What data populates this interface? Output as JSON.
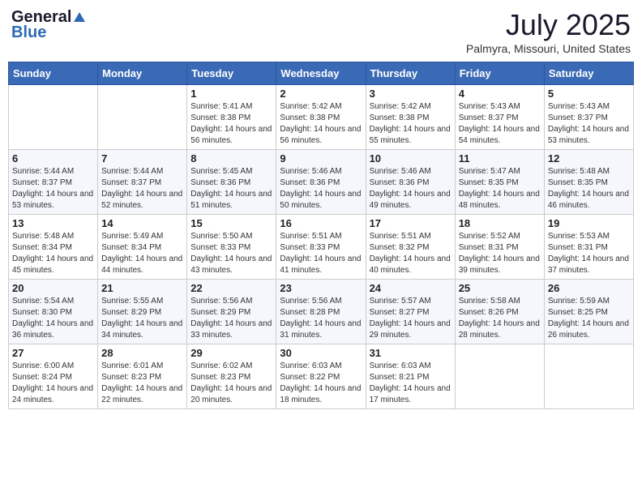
{
  "logo": {
    "general": "General",
    "blue": "Blue"
  },
  "title": "July 2025",
  "location": "Palmyra, Missouri, United States",
  "days_of_week": [
    "Sunday",
    "Monday",
    "Tuesday",
    "Wednesday",
    "Thursday",
    "Friday",
    "Saturday"
  ],
  "weeks": [
    [
      {
        "day": "",
        "sunrise": "",
        "sunset": "",
        "daylight": ""
      },
      {
        "day": "",
        "sunrise": "",
        "sunset": "",
        "daylight": ""
      },
      {
        "day": "1",
        "sunrise": "Sunrise: 5:41 AM",
        "sunset": "Sunset: 8:38 PM",
        "daylight": "Daylight: 14 hours and 56 minutes."
      },
      {
        "day": "2",
        "sunrise": "Sunrise: 5:42 AM",
        "sunset": "Sunset: 8:38 PM",
        "daylight": "Daylight: 14 hours and 56 minutes."
      },
      {
        "day": "3",
        "sunrise": "Sunrise: 5:42 AM",
        "sunset": "Sunset: 8:38 PM",
        "daylight": "Daylight: 14 hours and 55 minutes."
      },
      {
        "day": "4",
        "sunrise": "Sunrise: 5:43 AM",
        "sunset": "Sunset: 8:37 PM",
        "daylight": "Daylight: 14 hours and 54 minutes."
      },
      {
        "day": "5",
        "sunrise": "Sunrise: 5:43 AM",
        "sunset": "Sunset: 8:37 PM",
        "daylight": "Daylight: 14 hours and 53 minutes."
      }
    ],
    [
      {
        "day": "6",
        "sunrise": "Sunrise: 5:44 AM",
        "sunset": "Sunset: 8:37 PM",
        "daylight": "Daylight: 14 hours and 53 minutes."
      },
      {
        "day": "7",
        "sunrise": "Sunrise: 5:44 AM",
        "sunset": "Sunset: 8:37 PM",
        "daylight": "Daylight: 14 hours and 52 minutes."
      },
      {
        "day": "8",
        "sunrise": "Sunrise: 5:45 AM",
        "sunset": "Sunset: 8:36 PM",
        "daylight": "Daylight: 14 hours and 51 minutes."
      },
      {
        "day": "9",
        "sunrise": "Sunrise: 5:46 AM",
        "sunset": "Sunset: 8:36 PM",
        "daylight": "Daylight: 14 hours and 50 minutes."
      },
      {
        "day": "10",
        "sunrise": "Sunrise: 5:46 AM",
        "sunset": "Sunset: 8:36 PM",
        "daylight": "Daylight: 14 hours and 49 minutes."
      },
      {
        "day": "11",
        "sunrise": "Sunrise: 5:47 AM",
        "sunset": "Sunset: 8:35 PM",
        "daylight": "Daylight: 14 hours and 48 minutes."
      },
      {
        "day": "12",
        "sunrise": "Sunrise: 5:48 AM",
        "sunset": "Sunset: 8:35 PM",
        "daylight": "Daylight: 14 hours and 46 minutes."
      }
    ],
    [
      {
        "day": "13",
        "sunrise": "Sunrise: 5:48 AM",
        "sunset": "Sunset: 8:34 PM",
        "daylight": "Daylight: 14 hours and 45 minutes."
      },
      {
        "day": "14",
        "sunrise": "Sunrise: 5:49 AM",
        "sunset": "Sunset: 8:34 PM",
        "daylight": "Daylight: 14 hours and 44 minutes."
      },
      {
        "day": "15",
        "sunrise": "Sunrise: 5:50 AM",
        "sunset": "Sunset: 8:33 PM",
        "daylight": "Daylight: 14 hours and 43 minutes."
      },
      {
        "day": "16",
        "sunrise": "Sunrise: 5:51 AM",
        "sunset": "Sunset: 8:33 PM",
        "daylight": "Daylight: 14 hours and 41 minutes."
      },
      {
        "day": "17",
        "sunrise": "Sunrise: 5:51 AM",
        "sunset": "Sunset: 8:32 PM",
        "daylight": "Daylight: 14 hours and 40 minutes."
      },
      {
        "day": "18",
        "sunrise": "Sunrise: 5:52 AM",
        "sunset": "Sunset: 8:31 PM",
        "daylight": "Daylight: 14 hours and 39 minutes."
      },
      {
        "day": "19",
        "sunrise": "Sunrise: 5:53 AM",
        "sunset": "Sunset: 8:31 PM",
        "daylight": "Daylight: 14 hours and 37 minutes."
      }
    ],
    [
      {
        "day": "20",
        "sunrise": "Sunrise: 5:54 AM",
        "sunset": "Sunset: 8:30 PM",
        "daylight": "Daylight: 14 hours and 36 minutes."
      },
      {
        "day": "21",
        "sunrise": "Sunrise: 5:55 AM",
        "sunset": "Sunset: 8:29 PM",
        "daylight": "Daylight: 14 hours and 34 minutes."
      },
      {
        "day": "22",
        "sunrise": "Sunrise: 5:56 AM",
        "sunset": "Sunset: 8:29 PM",
        "daylight": "Daylight: 14 hours and 33 minutes."
      },
      {
        "day": "23",
        "sunrise": "Sunrise: 5:56 AM",
        "sunset": "Sunset: 8:28 PM",
        "daylight": "Daylight: 14 hours and 31 minutes."
      },
      {
        "day": "24",
        "sunrise": "Sunrise: 5:57 AM",
        "sunset": "Sunset: 8:27 PM",
        "daylight": "Daylight: 14 hours and 29 minutes."
      },
      {
        "day": "25",
        "sunrise": "Sunrise: 5:58 AM",
        "sunset": "Sunset: 8:26 PM",
        "daylight": "Daylight: 14 hours and 28 minutes."
      },
      {
        "day": "26",
        "sunrise": "Sunrise: 5:59 AM",
        "sunset": "Sunset: 8:25 PM",
        "daylight": "Daylight: 14 hours and 26 minutes."
      }
    ],
    [
      {
        "day": "27",
        "sunrise": "Sunrise: 6:00 AM",
        "sunset": "Sunset: 8:24 PM",
        "daylight": "Daylight: 14 hours and 24 minutes."
      },
      {
        "day": "28",
        "sunrise": "Sunrise: 6:01 AM",
        "sunset": "Sunset: 8:23 PM",
        "daylight": "Daylight: 14 hours and 22 minutes."
      },
      {
        "day": "29",
        "sunrise": "Sunrise: 6:02 AM",
        "sunset": "Sunset: 8:23 PM",
        "daylight": "Daylight: 14 hours and 20 minutes."
      },
      {
        "day": "30",
        "sunrise": "Sunrise: 6:03 AM",
        "sunset": "Sunset: 8:22 PM",
        "daylight": "Daylight: 14 hours and 18 minutes."
      },
      {
        "day": "31",
        "sunrise": "Sunrise: 6:03 AM",
        "sunset": "Sunset: 8:21 PM",
        "daylight": "Daylight: 14 hours and 17 minutes."
      },
      {
        "day": "",
        "sunrise": "",
        "sunset": "",
        "daylight": ""
      },
      {
        "day": "",
        "sunrise": "",
        "sunset": "",
        "daylight": ""
      }
    ]
  ]
}
